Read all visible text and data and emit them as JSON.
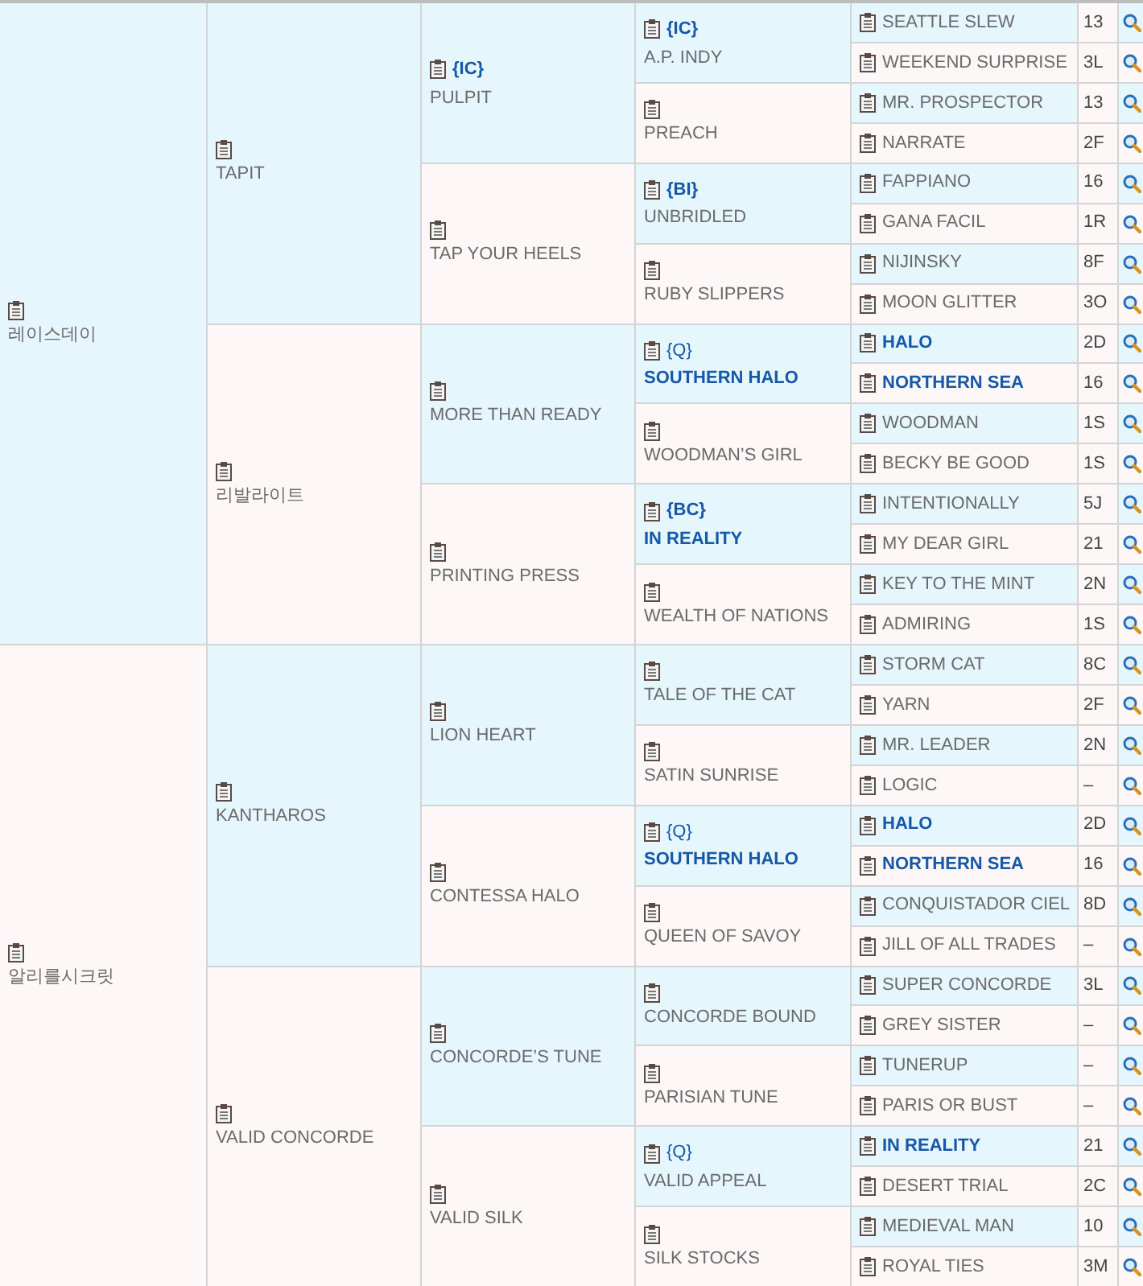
{
  "pedigree": [
    {
      "name": "레이스데이",
      "highlighted": false,
      "children": [
        {
          "name": "TAPIT",
          "highlighted": false,
          "children": [
            {
              "name": "PULPIT",
              "tag": "{IC}",
              "tag_bold": true,
              "highlighted": false,
              "children": [
                {
                  "name": "A.P. INDY",
                  "tag": "{IC}",
                  "tag_bold": true,
                  "highlighted": false,
                  "children": [
                    {
                      "name": "SEATTLE SLEW",
                      "code": "13",
                      "highlighted": false
                    },
                    {
                      "name": "WEEKEND SURPRISE",
                      "code": "3L",
                      "highlighted": false
                    }
                  ]
                },
                {
                  "name": "PREACH",
                  "highlighted": false,
                  "children": [
                    {
                      "name": "MR. PROSPECTOR",
                      "code": "13",
                      "highlighted": false
                    },
                    {
                      "name": "NARRATE",
                      "code": "2F",
                      "highlighted": false
                    }
                  ]
                }
              ]
            },
            {
              "name": "TAP YOUR HEELS",
              "highlighted": false,
              "children": [
                {
                  "name": "UNBRIDLED",
                  "tag": "{BI}",
                  "tag_bold": true,
                  "highlighted": false,
                  "children": [
                    {
                      "name": "FAPPIANO",
                      "code": "16",
                      "highlighted": false
                    },
                    {
                      "name": "GANA FACIL",
                      "code": "1R",
                      "highlighted": false
                    }
                  ]
                },
                {
                  "name": "RUBY SLIPPERS",
                  "highlighted": false,
                  "children": [
                    {
                      "name": "NIJINSKY",
                      "code": "8F",
                      "highlighted": false
                    },
                    {
                      "name": "MOON GLITTER",
                      "code": "3O",
                      "highlighted": false
                    }
                  ]
                }
              ]
            }
          ]
        },
        {
          "name": "리발라이트",
          "highlighted": false,
          "children": [
            {
              "name": "MORE THAN READY",
              "highlighted": false,
              "children": [
                {
                  "name": "SOUTHERN HALO",
                  "tag": "{Q}",
                  "tag_bold": false,
                  "highlighted": true,
                  "children": [
                    {
                      "name": "HALO",
                      "code": "2D",
                      "highlighted": true
                    },
                    {
                      "name": "NORTHERN SEA",
                      "code": "16",
                      "highlighted": true
                    }
                  ]
                },
                {
                  "name": "WOODMAN’S GIRL",
                  "highlighted": false,
                  "children": [
                    {
                      "name": "WOODMAN",
                      "code": "1S",
                      "highlighted": false
                    },
                    {
                      "name": "BECKY BE GOOD",
                      "code": "1S",
                      "highlighted": false
                    }
                  ]
                }
              ]
            },
            {
              "name": "PRINTING PRESS",
              "highlighted": false,
              "children": [
                {
                  "name": "IN REALITY",
                  "tag": "{BC}",
                  "tag_bold": true,
                  "highlighted": true,
                  "children": [
                    {
                      "name": "INTENTIONALLY",
                      "code": "5J",
                      "highlighted": false
                    },
                    {
                      "name": "MY DEAR GIRL",
                      "code": "21",
                      "highlighted": false
                    }
                  ]
                },
                {
                  "name": "WEALTH OF NATIONS",
                  "highlighted": false,
                  "children": [
                    {
                      "name": "KEY TO THE MINT",
                      "code": "2N",
                      "highlighted": false
                    },
                    {
                      "name": "ADMIRING",
                      "code": "1S",
                      "highlighted": false
                    }
                  ]
                }
              ]
            }
          ]
        }
      ]
    },
    {
      "name": "알리를시크릿",
      "highlighted": false,
      "children": [
        {
          "name": "KANTHAROS",
          "highlighted": false,
          "children": [
            {
              "name": "LION HEART",
              "highlighted": false,
              "children": [
                {
                  "name": "TALE OF THE CAT",
                  "highlighted": false,
                  "children": [
                    {
                      "name": "STORM CAT",
                      "code": "8C",
                      "highlighted": false
                    },
                    {
                      "name": "YARN",
                      "code": "2F",
                      "highlighted": false
                    }
                  ]
                },
                {
                  "name": "SATIN SUNRISE",
                  "highlighted": false,
                  "children": [
                    {
                      "name": "MR. LEADER",
                      "code": "2N",
                      "highlighted": false
                    },
                    {
                      "name": "LOGIC",
                      "code": "–",
                      "highlighted": false
                    }
                  ]
                }
              ]
            },
            {
              "name": "CONTESSA HALO",
              "highlighted": false,
              "children": [
                {
                  "name": "SOUTHERN HALO",
                  "tag": "{Q}",
                  "tag_bold": false,
                  "highlighted": true,
                  "children": [
                    {
                      "name": "HALO",
                      "code": "2D",
                      "highlighted": true
                    },
                    {
                      "name": "NORTHERN SEA",
                      "code": "16",
                      "highlighted": true
                    }
                  ]
                },
                {
                  "name": "QUEEN OF SAVOY",
                  "highlighted": false,
                  "children": [
                    {
                      "name": "CONQUISTADOR CIEL",
                      "code": "8D",
                      "highlighted": false
                    },
                    {
                      "name": "JILL OF ALL TRADES",
                      "code": "–",
                      "highlighted": false
                    }
                  ]
                }
              ]
            }
          ]
        },
        {
          "name": "VALID CONCORDE",
          "highlighted": false,
          "children": [
            {
              "name": "CONCORDE’S TUNE",
              "highlighted": false,
              "children": [
                {
                  "name": "CONCORDE BOUND",
                  "highlighted": false,
                  "children": [
                    {
                      "name": "SUPER CONCORDE",
                      "code": "3L",
                      "highlighted": false
                    },
                    {
                      "name": "GREY SISTER",
                      "code": "–",
                      "highlighted": false
                    }
                  ]
                },
                {
                  "name": "PARISIAN TUNE",
                  "highlighted": false,
                  "children": [
                    {
                      "name": "TUNERUP",
                      "code": "–",
                      "highlighted": false
                    },
                    {
                      "name": "PARIS OR BUST",
                      "code": "–",
                      "highlighted": false
                    }
                  ]
                }
              ]
            },
            {
              "name": "VALID SILK",
              "highlighted": false,
              "children": [
                {
                  "name": "VALID APPEAL",
                  "tag": "{Q}",
                  "tag_bold": false,
                  "highlighted": false,
                  "children": [
                    {
                      "name": "IN REALITY",
                      "code": "21",
                      "highlighted": true
                    },
                    {
                      "name": "DESERT TRIAL",
                      "code": "2C",
                      "highlighted": false
                    }
                  ]
                },
                {
                  "name": "SILK STOCKS",
                  "highlighted": false,
                  "children": [
                    {
                      "name": "MEDIEVAL MAN",
                      "code": "10",
                      "highlighted": false
                    },
                    {
                      "name": "ROYAL TIES",
                      "code": "3M",
                      "highlighted": false
                    }
                  ]
                }
              ]
            }
          ]
        }
      ]
    }
  ]
}
